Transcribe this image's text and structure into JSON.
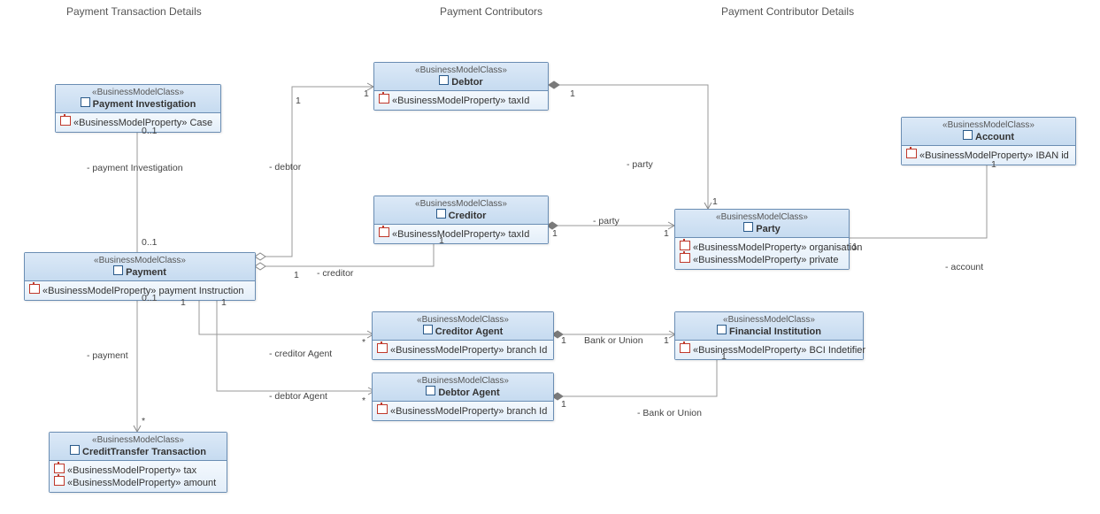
{
  "stereotype": "«BusinessModelClass»",
  "propStereo": "«BusinessModelProperty» ",
  "sections": {
    "left": "Payment Transaction Details",
    "mid": "Payment Contributors",
    "right": "Payment Contributor Details"
  },
  "classes": {
    "paymentInvestigation": {
      "name": "Payment Investigation",
      "props": [
        "Case"
      ]
    },
    "payment": {
      "name": "Payment",
      "props": [
        "payment Instruction"
      ]
    },
    "creditTransfer": {
      "name": "CreditTransfer Transaction",
      "props": [
        "tax",
        "amount"
      ]
    },
    "debtor": {
      "name": "Debtor",
      "props": [
        "taxId"
      ]
    },
    "creditor": {
      "name": "Creditor",
      "props": [
        "taxId"
      ]
    },
    "creditorAgent": {
      "name": "Creditor Agent",
      "props": [
        "branch Id"
      ]
    },
    "debtorAgent": {
      "name": "Debtor Agent",
      "props": [
        "branch Id"
      ]
    },
    "party": {
      "name": "Party",
      "props": [
        "organisation",
        "private"
      ]
    },
    "financialInstitution": {
      "name": "Financial Institution",
      "props": [
        "BCI Indetifier"
      ]
    },
    "account": {
      "name": "Account",
      "props": [
        "IBAN id"
      ]
    }
  },
  "labels": {
    "pinv": "- payment Investigation",
    "pay": "- payment",
    "deb": "- debtor",
    "cred": "- creditor",
    "credAg": "- creditor Agent",
    "debAg": "- debtor Agent",
    "party": "- party",
    "acct": "- account",
    "bank": "- Bank or Union",
    "bank2": "Bank or Union",
    "m01": "0..1",
    "m1": "1",
    "mn": "*"
  }
}
